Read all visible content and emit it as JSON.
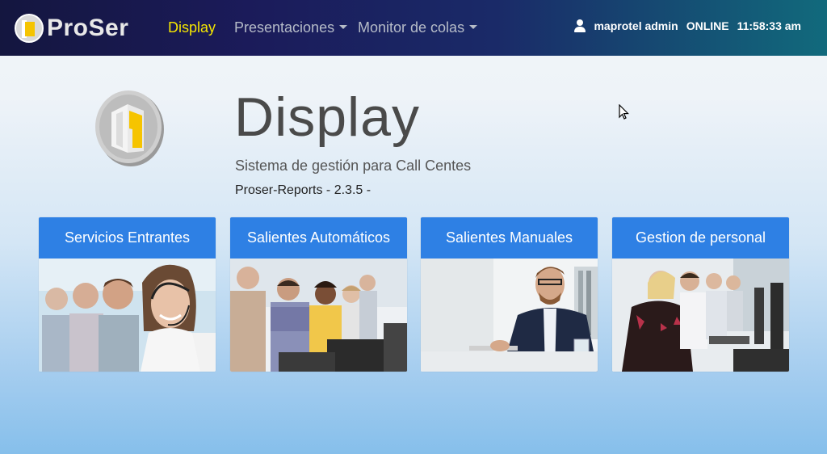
{
  "navbar": {
    "brand": "ProSer",
    "links": [
      {
        "label": "Display",
        "active": true
      },
      {
        "label": "Presentaciones",
        "dropdown": true
      },
      {
        "label": "Monitor de colas",
        "dropdown": true
      }
    ],
    "user": "maprotel admin",
    "status": "ONLINE",
    "time": "11:58:33 am"
  },
  "hero": {
    "title": "Display",
    "subtitle": "Sistema de gestión para Call Centes",
    "version": "Proser-Reports - 2.3.5 -"
  },
  "cards": [
    {
      "title": "Servicios Entrantes",
      "image": "smiling-agents-with-headsets"
    },
    {
      "title": "Salientes Automáticos",
      "image": "agents-working-at-computers"
    },
    {
      "title": "Salientes Manuales",
      "image": "man-with-headset-at-desk"
    },
    {
      "title": "Gestion de personal",
      "image": "call-center-row-of-agents"
    }
  ],
  "colors": {
    "nav_active": "#f5e600",
    "card_header": "#2e80e4"
  }
}
